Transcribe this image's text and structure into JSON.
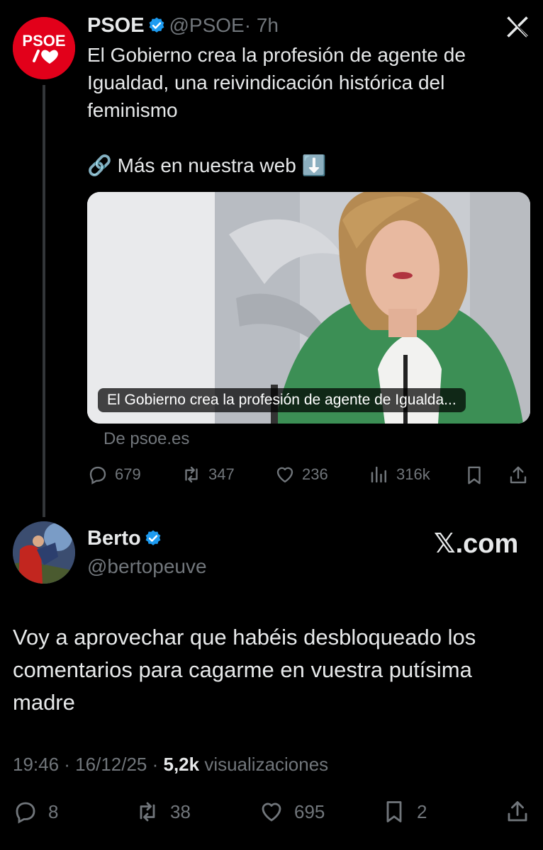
{
  "tweet": {
    "author_name": "PSOE",
    "author_handle": "@PSOE",
    "time": "· 7h",
    "avatar_text": "PSOE",
    "text_lines": [
      "El Gobierno crea la profesión de agente de",
      "Igualdad, una reivindicación histórica del",
      "feminismo"
    ],
    "link_line": "🔗 Más en nuestra web ⬇️",
    "media_caption": "El Gobierno crea la profesión de agente de Igualda...",
    "source": "De psoe.es",
    "replies": "679",
    "retweets": "347",
    "likes": "236",
    "views": "316k",
    "close_icon": "x-close-icon",
    "colors": {
      "psoe_red": "#e2001a",
      "verified_blue": "#1d9bf0",
      "jacket_green": "#3c8f55"
    }
  },
  "reply": {
    "author_name": "Berto",
    "author_handle": "@bertopeuve",
    "brand": "𝕏.com",
    "text": "Voy a aprovechar que habéis desbloqueado los comentarios para cagarme en vuestra putísima madre",
    "time": "19:46 · 16/12/25 · ",
    "views_count": "5,2k",
    "views_label": " visualizaciones",
    "replies": "8",
    "retweets": "38",
    "likes": "695",
    "bookmarks": "2"
  }
}
